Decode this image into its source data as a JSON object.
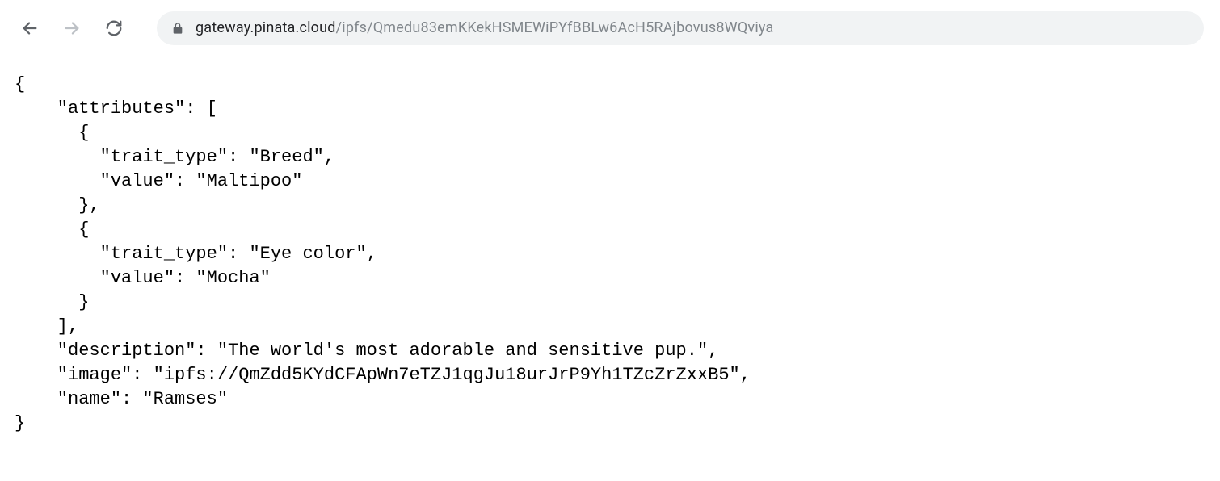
{
  "url": {
    "domain": "gateway.pinata.cloud",
    "path": "/ipfs/Qmedu83emKKekHSMEWiPYfBBLw6AcH5RAjbovus8WQviya"
  },
  "json_content": {
    "open_brace": "{",
    "attributes_key": "    \"attributes\": [",
    "attr1_open": "      {",
    "attr1_trait": "        \"trait_type\": \"Breed\",",
    "attr1_value": "        \"value\": \"Maltipoo\"",
    "attr1_close": "      },",
    "attr2_open": "      {",
    "attr2_trait": "        \"trait_type\": \"Eye color\",",
    "attr2_value": "        \"value\": \"Mocha\"",
    "attr2_close": "      }",
    "attributes_close": "    ],",
    "description": "    \"description\": \"The world's most adorable and sensitive pup.\",",
    "image": "    \"image\": \"ipfs://QmZdd5KYdCFApWn7eTZJ1qgJu18urJrP9Yh1TZcZrZxxB5\",",
    "name": "    \"name\": \"Ramses\"",
    "close_brace": "}"
  }
}
